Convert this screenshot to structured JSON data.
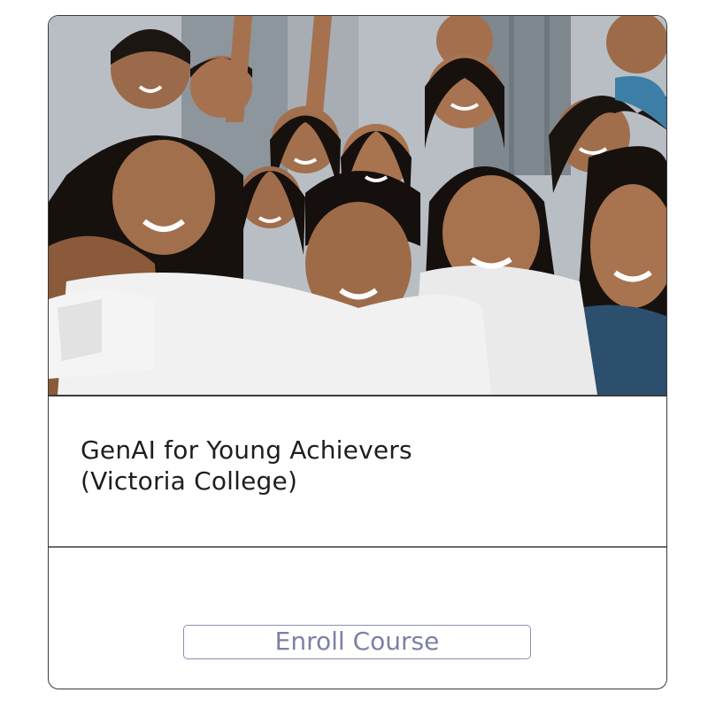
{
  "course": {
    "title_line1": "GenAI for Young Achievers",
    "title_line2": "(Victoria College)",
    "image_alt": "Group of smiling young students taking a selfie"
  },
  "actions": {
    "enroll_label": "Enroll Course"
  },
  "colors": {
    "card_border": "#3a3a3a",
    "title_text": "#1e1e1e",
    "button_border": "#8a8fb2",
    "button_text": "#7b80a6"
  }
}
